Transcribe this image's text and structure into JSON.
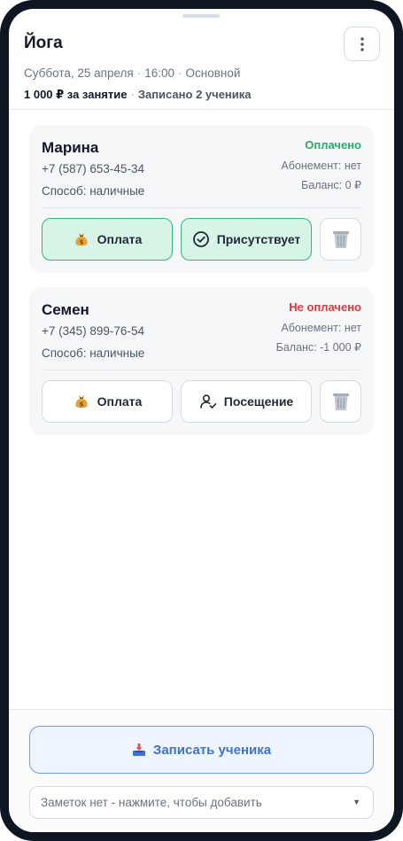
{
  "header": {
    "title": "Йога",
    "date": "Суббота, 25 апреля",
    "time": "16:00",
    "hall": "Основной",
    "price": "1 000 ₽ за занятие",
    "enrolled": "Записано 2 ученика",
    "menu_icon": "more-vertical-icon"
  },
  "students": [
    {
      "name": "Марина",
      "phone": "+7 (587) 653-45-34",
      "method": "Способ: наличные",
      "status": "Оплачено",
      "subscription": "Абонемент: нет",
      "balance": "Баланс: 0 ₽",
      "pay_label": "Оплата",
      "attend_label": "Присутствует",
      "attended": true,
      "paid": true
    },
    {
      "name": "Семен",
      "phone": "+7 (345) 899-76-54",
      "method": "Способ: наличные",
      "status": "Не оплачено",
      "subscription": "Абонемент: нет",
      "balance": "Баланс: -1 000 ₽",
      "pay_label": "Оплата",
      "attend_label": "Посещение",
      "attended": false,
      "paid": false
    }
  ],
  "footer": {
    "enroll_label": "Записать ученика",
    "notes_placeholder": "Заметок нет - нажмите, чтобы добавить",
    "notes_caret": "▼"
  },
  "colors": {
    "paid": "#2aa96a",
    "unpaid": "#d93a3a",
    "accent": "#3d74c6",
    "attend_active_bg": "#d6f5e6"
  }
}
